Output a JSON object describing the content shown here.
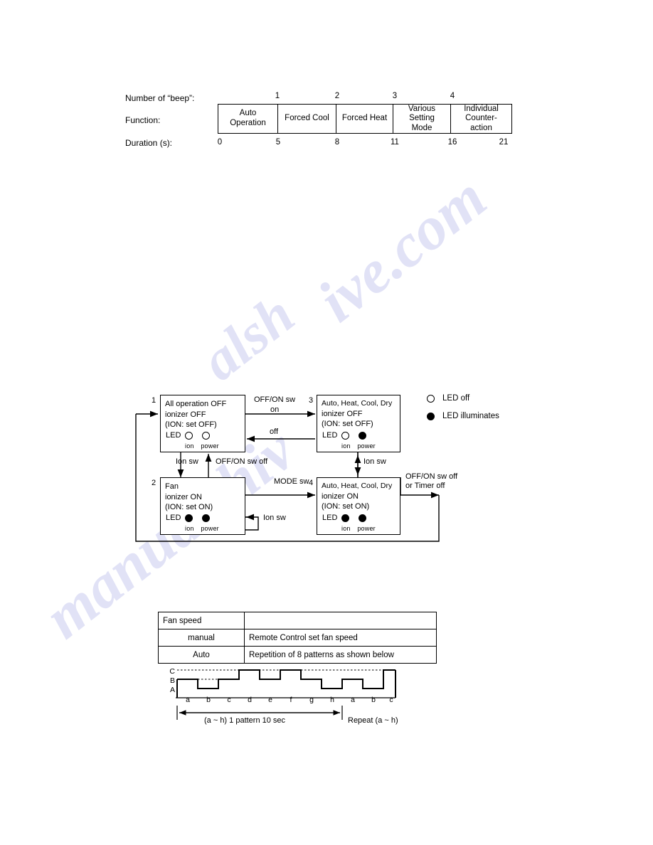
{
  "beep_table": {
    "row_labels": {
      "number": "Number of “beep”:",
      "function": "Function:",
      "duration": "Duration (s):"
    },
    "beep_counts": [
      "1",
      "2",
      "3",
      "4"
    ],
    "cells": [
      "Auto\nOperation",
      "Forced Cool",
      "Forced Heat",
      "Various\nSetting\nMode",
      "Individual\nCounter-\naction"
    ],
    "cell_lines": [
      [
        "Auto",
        "Operation"
      ],
      [
        "Forced Cool"
      ],
      [
        "Forced Heat"
      ],
      [
        "Various",
        "Setting",
        "Mode"
      ],
      [
        "Individual",
        "Counter-",
        "action"
      ]
    ],
    "durations": [
      "0",
      "5",
      "8",
      "11",
      "16",
      "21"
    ]
  },
  "state_diagram": {
    "states": [
      {
        "number": "1",
        "lines": [
          "All operation OFF",
          "ionizer OFF",
          "(ION: set OFF)"
        ],
        "led_label": "LED",
        "leds": [
          "off",
          "off"
        ],
        "led_captions": [
          "ion",
          "power"
        ]
      },
      {
        "number": "3",
        "lines": [
          "Auto, Heat, Cool, Dry",
          "ionizer OFF",
          "(ION: set OFF)"
        ],
        "led_label": "LED",
        "leds": [
          "off",
          "on"
        ],
        "led_captions": [
          "ion",
          "power"
        ]
      },
      {
        "number": "2",
        "lines": [
          "Fan",
          "ionizer ON",
          "(ION: set ON)"
        ],
        "led_label": "LED",
        "leds": [
          "on",
          "on"
        ],
        "led_captions": [
          "ion",
          "power"
        ]
      },
      {
        "number": "4",
        "lines": [
          "Auto, Heat, Cool, Dry",
          "ionizer ON",
          "(ION: set ON)"
        ],
        "led_label": "LED",
        "leds": [
          "on",
          "on"
        ],
        "led_captions": [
          "ion",
          "power"
        ]
      }
    ],
    "transitions": {
      "offon_sw": "OFF/ON sw",
      "on": "on",
      "off": "off",
      "ion_sw_1_2": "Ion sw",
      "offon_sw_off": "OFF/ON sw off",
      "ion_sw_3_4": "Ion sw",
      "mode_sw": "MODE sw",
      "ion_sw_self": "Ion sw",
      "offon_or_timer_line1": "OFF/ON sw off",
      "offon_or_timer_line2": "or Timer off"
    },
    "legend": [
      {
        "state": "off",
        "text": "LED off"
      },
      {
        "state": "on",
        "text": "LED illuminates"
      }
    ]
  },
  "fan_table": {
    "rows": [
      {
        "label": "Fan speed",
        "value": ""
      },
      {
        "label": "manual",
        "value": "Remote Control set fan speed"
      },
      {
        "label": "Auto",
        "value": "Repetition of 8 patterns as shown below"
      }
    ]
  },
  "chart_data": {
    "type": "line",
    "title": "Auto fan speed pattern",
    "xlabel": "",
    "ylabel": "",
    "levels": [
      "A",
      "B",
      "C"
    ],
    "categories": [
      "a",
      "b",
      "c",
      "d",
      "e",
      "f",
      "g",
      "h",
      "a",
      "b",
      "c"
    ],
    "values": [
      "B",
      "A",
      "B",
      "C",
      "B",
      "C",
      "B",
      "A",
      "A",
      "A",
      "B"
    ],
    "grid": false,
    "annotations": {
      "pattern": "(a ~ h) 1 pattern  10 sec",
      "repeat": "Repeat (a ~ h)"
    }
  },
  "colors": {
    "ink": "#000000",
    "paper": "#ffffff",
    "watermark": "#c9cbf0"
  },
  "watermark_text": {
    "a": "ive.com",
    "b": "manualshiv",
    "c": "alsh"
  }
}
